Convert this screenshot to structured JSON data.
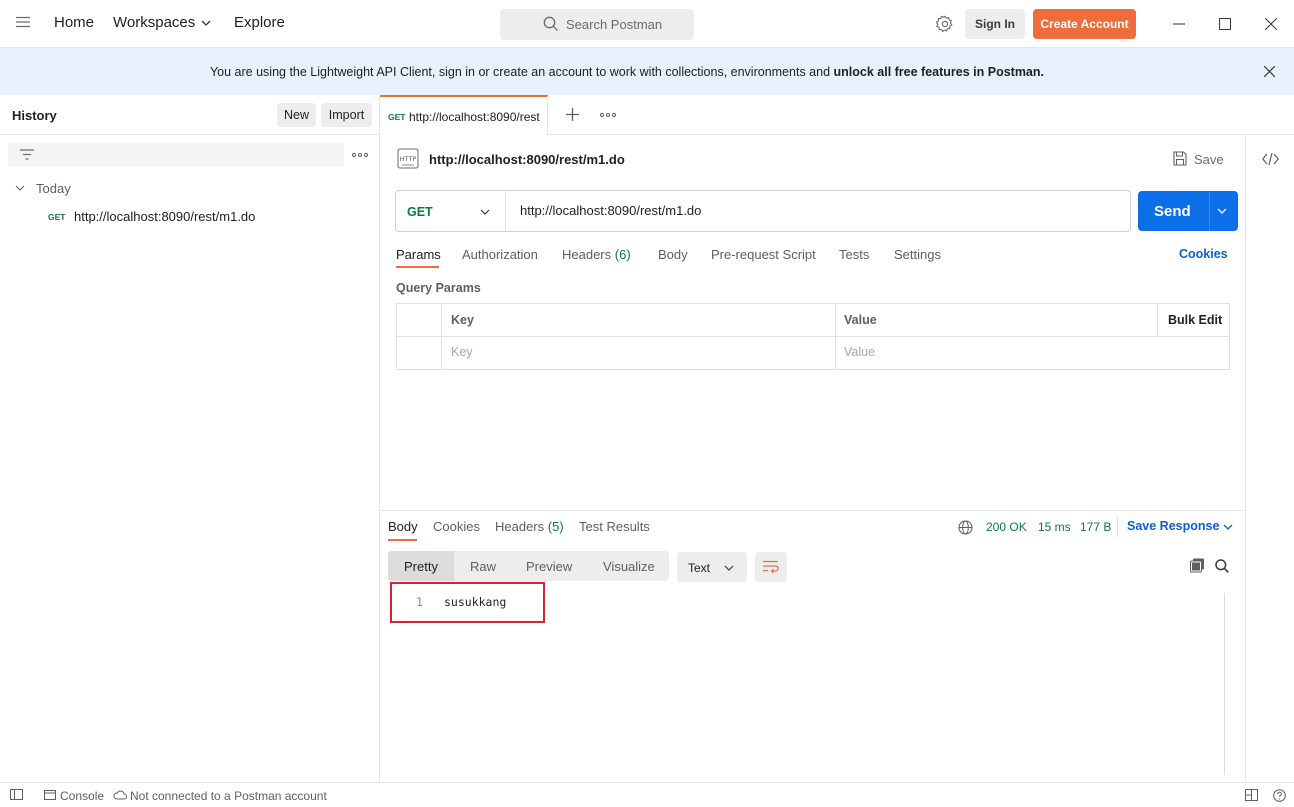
{
  "header": {
    "nav": {
      "home": "Home",
      "workspaces": "Workspaces",
      "explore": "Explore"
    },
    "search_placeholder": "Search Postman",
    "sign_in": "Sign In",
    "create_account": "Create Account"
  },
  "banner": {
    "text": "You are using the Lightweight API Client, sign in or create an account to work with collections, environments and",
    "bold": "unlock all free features in Postman."
  },
  "sidebar": {
    "title": "History",
    "new_label": "New",
    "import_label": "Import",
    "group_label": "Today",
    "items": [
      {
        "method": "GET",
        "url": "http://localhost:8090/rest/m1.do"
      }
    ]
  },
  "tab": {
    "method": "GET",
    "label": "http://localhost:8090/rest"
  },
  "request": {
    "title": "http://localhost:8090/rest/m1.do",
    "save_label": "Save",
    "method": "GET",
    "url": "http://localhost:8090/rest/m1.do",
    "send_label": "Send",
    "tabs": {
      "params": "Params",
      "authorization": "Authorization",
      "headers": "Headers",
      "headers_count": "(6)",
      "body": "Body",
      "prerequest": "Pre-request Script",
      "tests": "Tests",
      "settings": "Settings"
    },
    "cookies_link": "Cookies",
    "query_params_title": "Query Params",
    "table": {
      "key_header": "Key",
      "value_header": "Value",
      "bulk_edit": "Bulk Edit",
      "key_placeholder": "Key",
      "value_placeholder": "Value"
    }
  },
  "response": {
    "tabs": {
      "body": "Body",
      "cookies": "Cookies",
      "headers": "Headers",
      "headers_count": "(5)",
      "test_results": "Test Results"
    },
    "status": "200 OK",
    "time": "15 ms",
    "size": "177 B",
    "save_response": "Save Response",
    "view_modes": {
      "pretty": "Pretty",
      "raw": "Raw",
      "preview": "Preview",
      "visualize": "Visualize"
    },
    "format": "Text",
    "lines": [
      {
        "num": "1",
        "text": "susukkang"
      }
    ]
  },
  "footer": {
    "console": "Console",
    "status": "Not connected to a Postman account"
  },
  "colors": {
    "accent": "#ef6c3b",
    "primary": "#0d6fe8",
    "status_ok": "#0a7b3e",
    "highlight": "#d7232f"
  }
}
